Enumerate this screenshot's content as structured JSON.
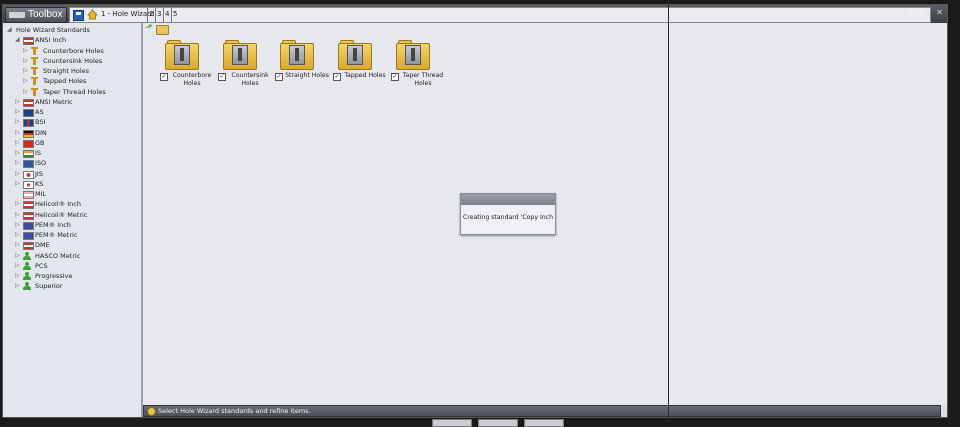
{
  "app": {
    "title": "Toolbox"
  },
  "breadcrumb": {
    "item1": "1 - Hole Wizard",
    "item2": "2",
    "item3": "3",
    "item4": "4",
    "item5": "5"
  },
  "window_controls": {
    "help": "?",
    "minimize": "–",
    "restore": "▫",
    "close": "✕"
  },
  "tree": [
    {
      "label": "Hole Wizard Standards",
      "icon": "none",
      "expander": "◢"
    },
    {
      "label": "ANSI Inch",
      "icon": "flag-us",
      "expander": "◢"
    },
    {
      "label": "Counterbore Holes",
      "icon": "hole",
      "expander": "▷"
    },
    {
      "label": "Countersink Holes",
      "icon": "hole",
      "expander": "▷"
    },
    {
      "label": "Straight Holes",
      "icon": "hole",
      "expander": "▷"
    },
    {
      "label": "Tapped Holes",
      "icon": "hole",
      "expander": "▷"
    },
    {
      "label": "Taper Thread Holes",
      "icon": "hole",
      "expander": "▷"
    },
    {
      "label": "ANSI Metric",
      "icon": "flag-us",
      "expander": "▷"
    },
    {
      "label": "AS",
      "icon": "flag-au",
      "expander": "▷"
    },
    {
      "label": "BSI",
      "icon": "flag-uk",
      "expander": "▷"
    },
    {
      "label": "DIN",
      "icon": "flag-de",
      "expander": "▷"
    },
    {
      "label": "GB",
      "icon": "flag-cn",
      "expander": "▷"
    },
    {
      "label": "IS",
      "icon": "flag-in",
      "expander": "▷"
    },
    {
      "label": "ISO",
      "icon": "flag-iso",
      "expander": "▷"
    },
    {
      "label": "JIS",
      "icon": "flag-jp",
      "expander": "▷"
    },
    {
      "label": "KS",
      "icon": "flag-kr",
      "expander": "▷"
    },
    {
      "label": "MIL",
      "icon": "flag-us-pale",
      "expander": ""
    },
    {
      "label": "Helicoil® Inch",
      "icon": "flag-us",
      "expander": "▷"
    },
    {
      "label": "Helicoil® Metric",
      "icon": "flag-us",
      "expander": "▷"
    },
    {
      "label": "PEM® Inch",
      "icon": "pem",
      "expander": "▷"
    },
    {
      "label": "PEM® Metric",
      "icon": "pem",
      "expander": "▷"
    },
    {
      "label": "DME",
      "icon": "flag-us",
      "expander": "▷"
    },
    {
      "label": "HASCO Metric",
      "icon": "person",
      "expander": "▷"
    },
    {
      "label": "PCS",
      "icon": "person",
      "expander": "▷"
    },
    {
      "label": "Progressive",
      "icon": "person",
      "expander": "▷"
    },
    {
      "label": "Superior",
      "icon": "person",
      "expander": "▷"
    }
  ],
  "tiles": [
    {
      "label": "Counterbore Holes",
      "checked": "✓"
    },
    {
      "label": "Countersink Holes",
      "checked": "✓"
    },
    {
      "label": "Straight Holes",
      "checked": "✓"
    },
    {
      "label": "Tapped Holes",
      "checked": "✓"
    },
    {
      "label": "Taper Thread Holes",
      "checked": "✓"
    }
  ],
  "dialog": {
    "message": "Creating standard 'Copy Inch"
  },
  "status": {
    "text": "Select Hole Wizard standards and refine items."
  },
  "colors": {
    "accent": "#d9a92c",
    "panel": "#e3e6ec",
    "titlebar": "#3c4046"
  }
}
